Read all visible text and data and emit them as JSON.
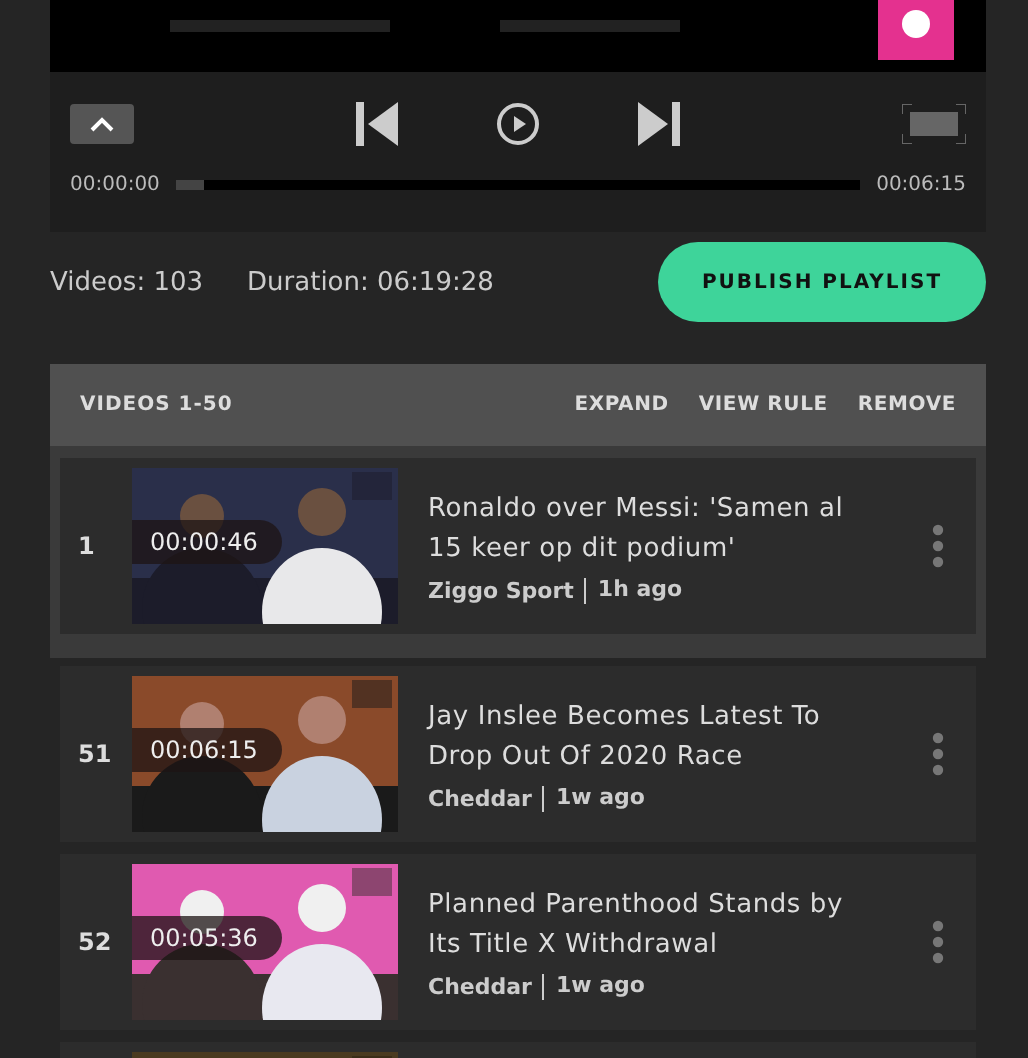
{
  "player": {
    "elapsed": "00:00:00",
    "total": "00:06:15",
    "level": 0.04
  },
  "summary": {
    "videos": "Videos: 103",
    "duration": "Duration: 06:19:28",
    "publish": "PUBLISH PLAYLIST"
  },
  "sections": [
    {
      "title": "VIDEOS 1-50",
      "actions": [
        "EXPAND",
        "VIEW RULE",
        "REMOVE"
      ],
      "rows": [
        {
          "index": "1",
          "duration": "00:00:46",
          "title": "Ronaldo over Messi: 'Samen al 15 keer op dit podium'",
          "source": "Ziggo Sport",
          "age": "1h ago"
        }
      ]
    },
    {
      "rows": [
        {
          "index": "51",
          "duration": "00:06:15",
          "title": "Jay Inslee Becomes Latest To Drop Out Of 2020 Race",
          "source": "Cheddar",
          "age": "1w ago"
        },
        {
          "index": "52",
          "duration": "00:05:36",
          "title": "Planned Parenthood Stands by Its Title X Withdrawal",
          "source": "Cheddar",
          "age": "1w ago"
        },
        {
          "kind": "picture"
        }
      ]
    }
  ]
}
